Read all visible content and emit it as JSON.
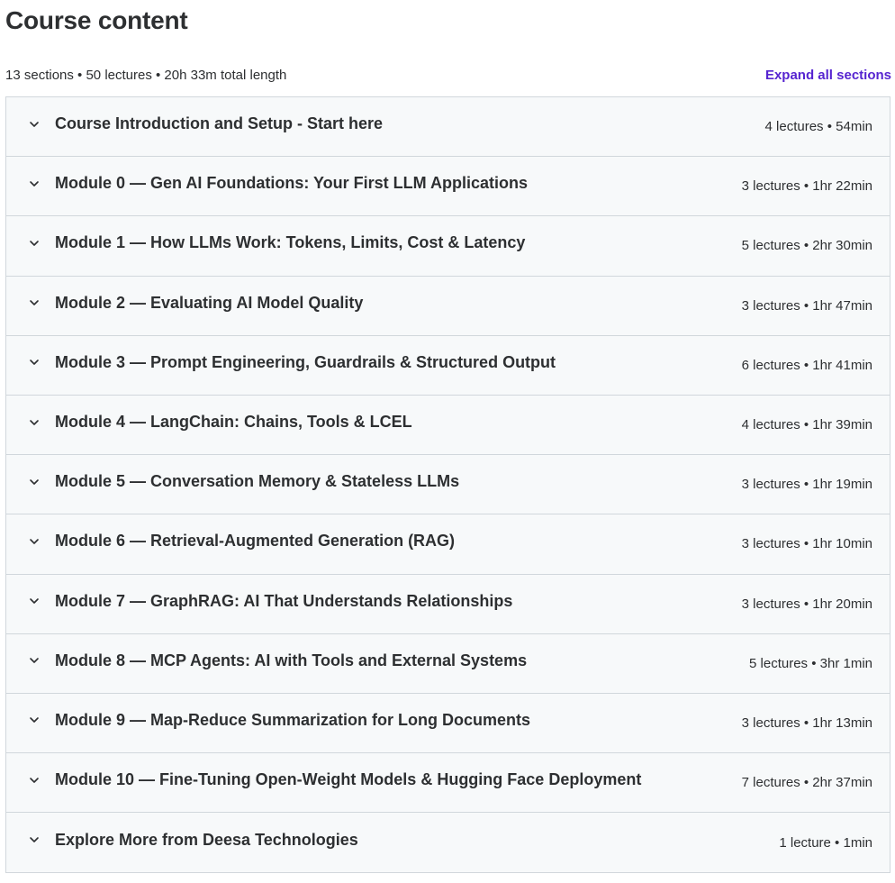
{
  "header": {
    "title": "Course content",
    "summary": "13 sections • 50 lectures • 20h 33m total length",
    "expand_all_label": "Expand all sections"
  },
  "icons": {
    "section_toggle": "chevron-down-icon"
  },
  "colors": {
    "accent": "#5624d0",
    "row_background": "#f7f9fa",
    "border": "#d1d7dc",
    "text": "#2d2f31"
  },
  "sections": [
    {
      "title": "Course Introduction and Setup - Start here",
      "meta": "4 lectures • 54min"
    },
    {
      "title": "Module 0 — Gen AI Foundations: Your First LLM Applications",
      "meta": "3 lectures • 1hr 22min"
    },
    {
      "title": "Module 1 — How LLMs Work: Tokens, Limits, Cost & Latency",
      "meta": "5 lectures • 2hr 30min"
    },
    {
      "title": "Module 2 — Evaluating AI Model Quality",
      "meta": "3 lectures • 1hr 47min"
    },
    {
      "title": "Module 3 — Prompt Engineering, Guardrails & Structured Output",
      "meta": "6 lectures • 1hr 41min"
    },
    {
      "title": "Module 4 — LangChain: Chains, Tools & LCEL",
      "meta": "4 lectures • 1hr 39min"
    },
    {
      "title": "Module 5 — Conversation Memory & Stateless LLMs",
      "meta": "3 lectures • 1hr 19min"
    },
    {
      "title": "Module 6 — Retrieval-Augmented Generation (RAG)",
      "meta": "3 lectures • 1hr 10min"
    },
    {
      "title": "Module 7 — GraphRAG: AI That Understands Relationships",
      "meta": "3 lectures • 1hr 20min"
    },
    {
      "title": "Module 8 — MCP Agents: AI with Tools and External Systems",
      "meta": "5 lectures • 3hr 1min"
    },
    {
      "title": "Module 9 — Map-Reduce Summarization for Long Documents",
      "meta": "3 lectures • 1hr 13min"
    },
    {
      "title": "Module 10 — Fine-Tuning Open-Weight Models & Hugging Face Deployment",
      "meta": "7 lectures • 2hr 37min"
    },
    {
      "title": "Explore More from Deesa Technologies",
      "meta": "1 lecture • 1min"
    }
  ]
}
